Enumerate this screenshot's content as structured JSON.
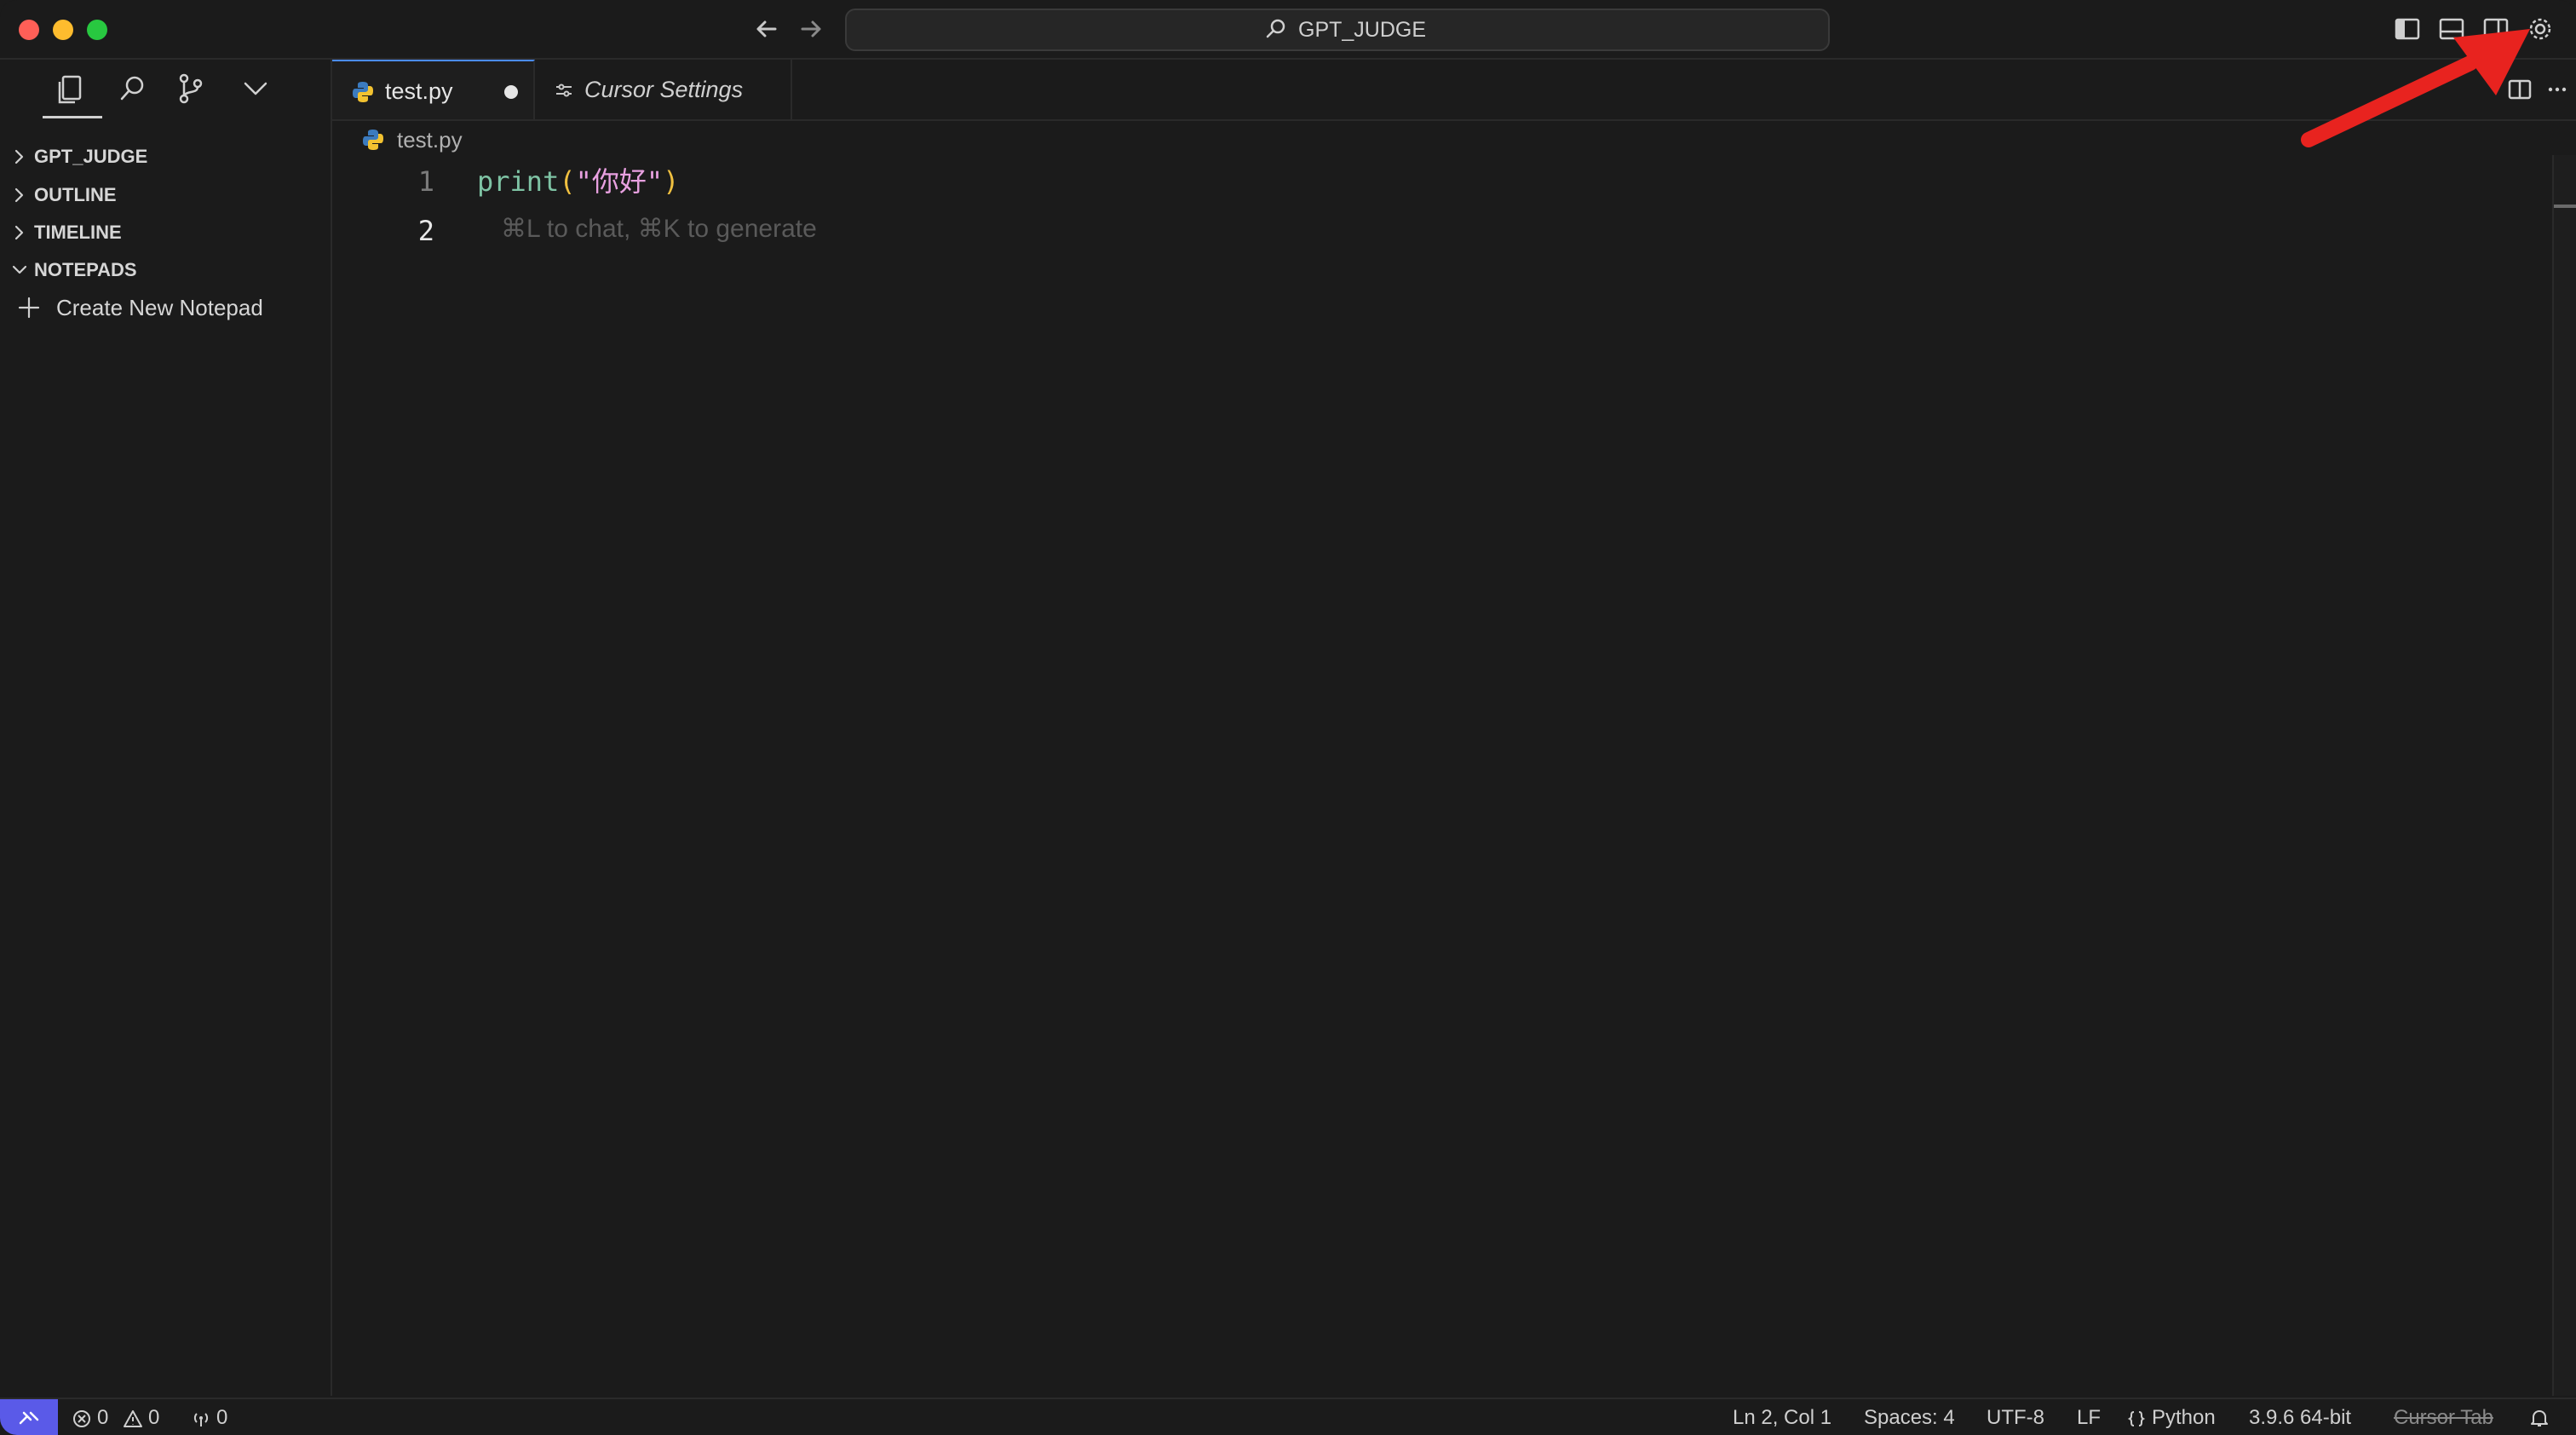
{
  "titlebar": {
    "search_text": "GPT_JUDGE"
  },
  "sidebar": {
    "sections": [
      {
        "label": "GPT_JUDGE",
        "expanded": false
      },
      {
        "label": "OUTLINE",
        "expanded": false
      },
      {
        "label": "TIMELINE",
        "expanded": false
      },
      {
        "label": "NOTEPADS",
        "expanded": true
      }
    ],
    "create_notepad_label": "Create New Notepad"
  },
  "tabs": [
    {
      "label": "test.py",
      "active": true,
      "unsaved": true,
      "icon": "python-icon"
    },
    {
      "label": "Cursor Settings",
      "active": false,
      "icon": "settings-sliders-icon"
    }
  ],
  "breadcrumb": {
    "file": "test.py"
  },
  "editor": {
    "line_numbers": [
      "1",
      "2"
    ],
    "code": {
      "fn": "print",
      "open_paren": "(",
      "string": "\"你好\"",
      "close_paren": ")"
    },
    "ghost_hint": "⌘L to chat, ⌘K to generate"
  },
  "statusbar": {
    "errors": "0",
    "warnings": "0",
    "ports": "0",
    "cursor_pos": "Ln 2, Col 1",
    "spaces": "Spaces: 4",
    "encoding": "UTF-8",
    "eol": "LF",
    "language": "Python",
    "interpreter": "3.9.6 64-bit",
    "cursor_tab": "Cursor Tab"
  },
  "colors": {
    "background": "#1b1b1b",
    "accent": "#4a8cff",
    "remote_indicator": "#5a5ae8",
    "annotation_arrow": "#e8231f",
    "string": "#e8a0e0",
    "function": "#7ec3a4"
  }
}
